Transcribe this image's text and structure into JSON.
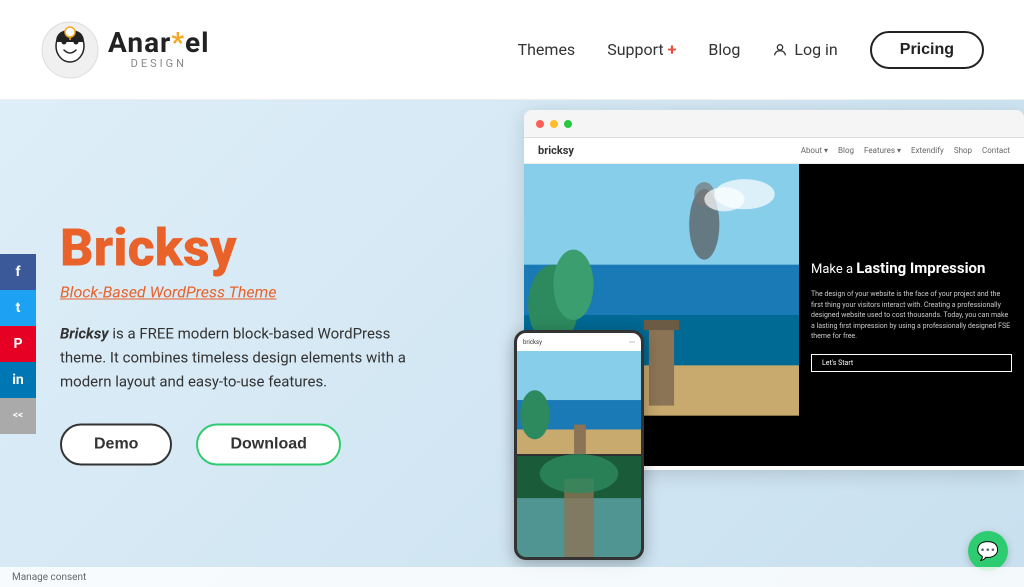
{
  "header": {
    "logo_name": "Anariel",
    "logo_star": "*",
    "logo_sub": "DESIGN",
    "nav": {
      "themes_label": "Themes",
      "support_label": "Support",
      "support_plus": "+",
      "blog_label": "Blog",
      "login_label": "Log in",
      "pricing_label": "Pricing"
    }
  },
  "hero": {
    "title": "Bricksy",
    "subtitle": "Block-Based WordPress Theme",
    "description_prefix": "Bricksy",
    "description_body": " is a FREE modern block-based WordPress theme. It combines timeless design elements with a modern layout and easy-to-use features.",
    "btn_demo": "Demo",
    "btn_download": "Download"
  },
  "social": {
    "facebook": "f",
    "twitter": "t",
    "pinterest": "p",
    "linkedin": "in",
    "collapse": "<<"
  },
  "mockup": {
    "site_name": "bricksy",
    "nav_items": [
      "About ▾",
      "Blog",
      "Features ▾",
      "Extendify",
      "Shop",
      "Contact"
    ],
    "headline": "Make a Lasting Impression",
    "body_text": "The design of your website is the face of your project and the first thing your visitors interact with. Creating a professionally designed website used to cost thousands. Today, you can make a lasting first impression by using a professionally designed FSE theme for free.",
    "cta": "Let's Start",
    "mobile_site_name": "bricksy"
  },
  "social_icons": {
    "facebook_char": "f",
    "twitter_char": "𝕏",
    "pinterest_char": "P",
    "linkedin_char": "in",
    "collapse_char": "<<"
  },
  "consent": {
    "text": "Manage consent"
  },
  "chat": {
    "icon": "💬"
  }
}
